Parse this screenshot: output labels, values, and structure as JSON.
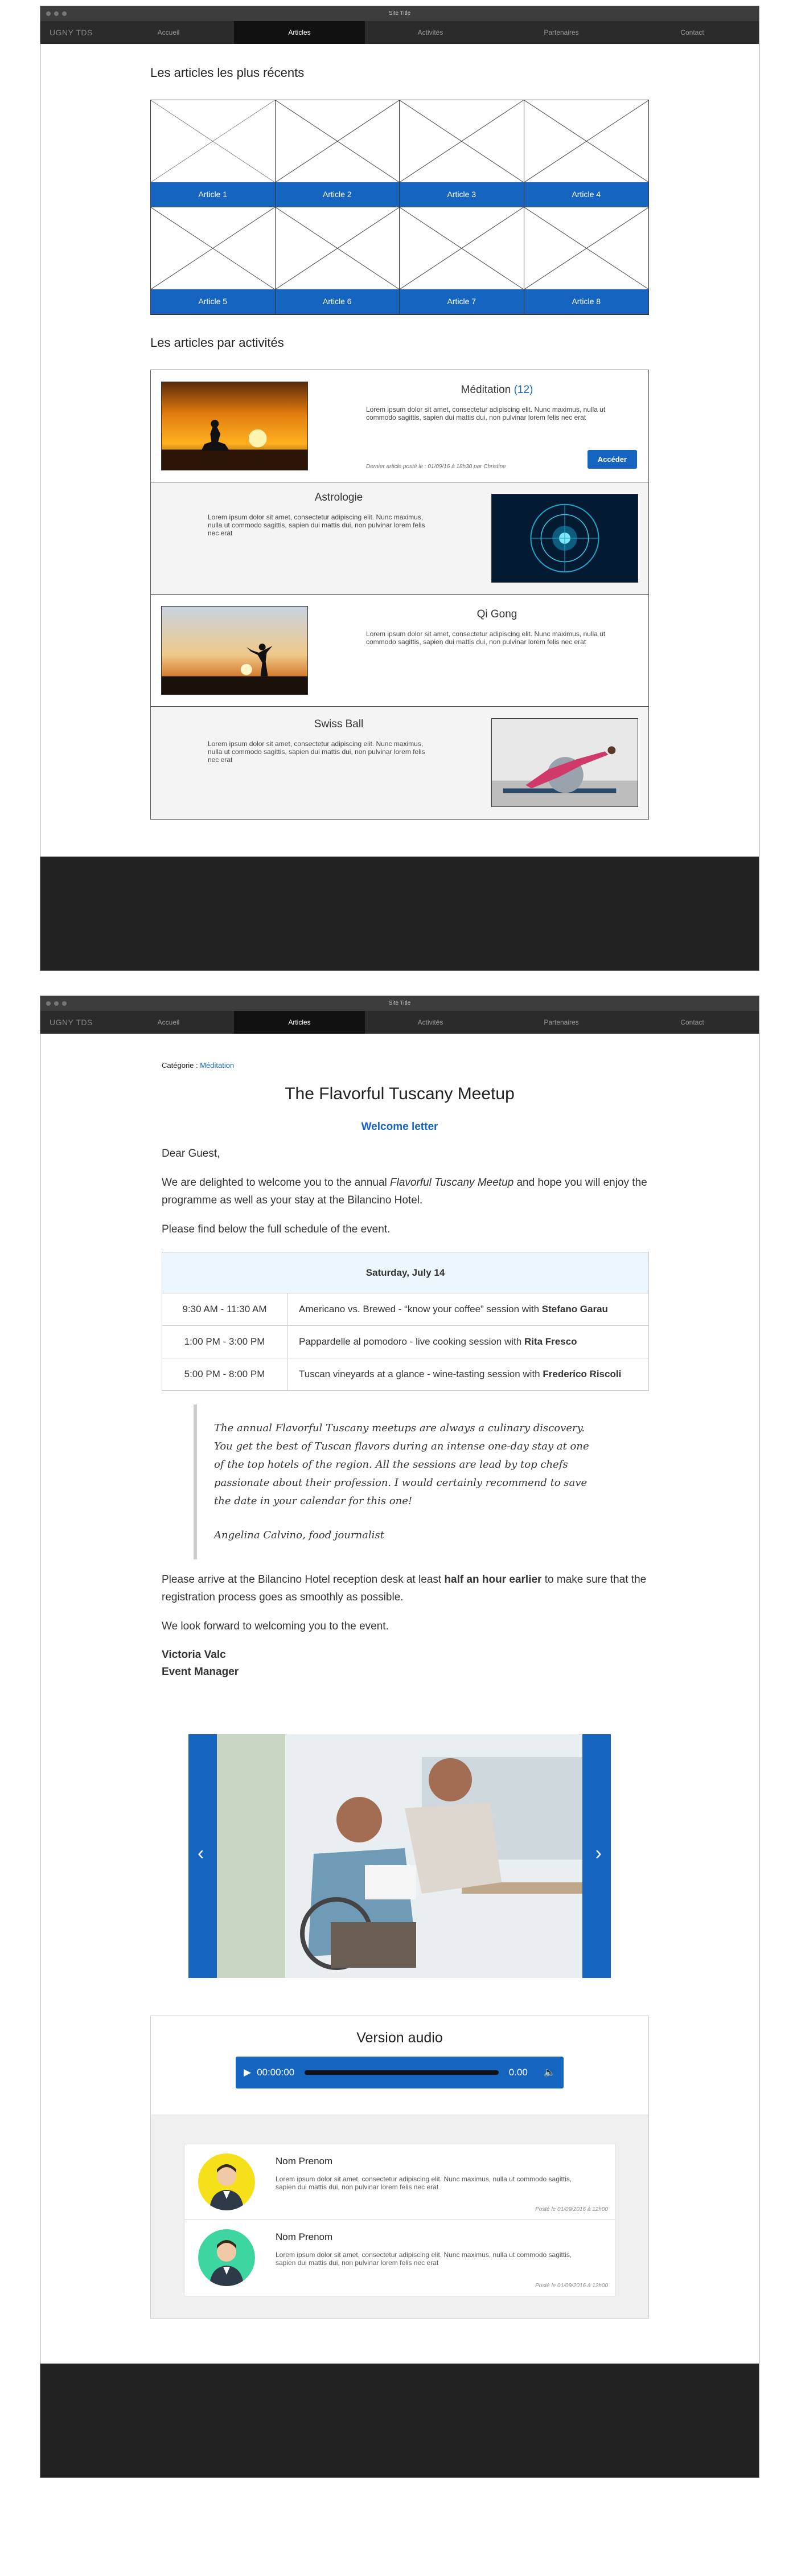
{
  "window": {
    "title": "Site Title"
  },
  "nav": {
    "logo": "UGNY TDS",
    "items": [
      "Accueil",
      "Articles",
      "Activités",
      "Partenaires",
      "Contact"
    ]
  },
  "listing": {
    "recent_title": "Les articles les plus récents",
    "articles": [
      "Article 1",
      "Article 2",
      "Article 3",
      "Article 4",
      "Article 5",
      "Article 6",
      "Article 7",
      "Article 8"
    ],
    "activities_title": "Les articles par activités",
    "activities": [
      {
        "name": "Méditation",
        "count": "(12)",
        "text": "Lorem ipsum dolor sit amet, consectetur adipiscing elit. Nunc maximus, nulla ut commodo sagittis, sapien dui mattis dui, non pulvinar lorem felis nec erat",
        "meta": "Dernier article posté le : 01/09/16 à 18h30 par Christine",
        "button": "Accéder"
      },
      {
        "name": "Astrologie",
        "text": "Lorem ipsum dolor sit amet, consectetur adipiscing elit. Nunc maximus, nulla ut commodo sagittis, sapien dui mattis dui, non pulvinar lorem felis nec erat"
      },
      {
        "name": "Qi Gong",
        "text": "Lorem ipsum dolor sit amet, consectetur adipiscing elit. Nunc maximus, nulla ut commodo sagittis, sapien dui mattis dui, non pulvinar lorem felis nec erat"
      },
      {
        "name": "Swiss Ball",
        "text": "Lorem ipsum dolor sit amet, consectetur adipiscing elit. Nunc maximus, nulla ut commodo sagittis, sapien dui mattis dui, non pulvinar lorem felis nec erat"
      }
    ]
  },
  "article": {
    "category_label": "Catégorie :",
    "category": "Méditation",
    "title": "The Flavorful Tuscany Meetup",
    "subtitle": "Welcome letter",
    "greeting": "Dear Guest,",
    "p1_a": "We are delighted to welcome you to the annual ",
    "p1_em": "Flavorful Tuscany Meetup",
    "p1_b": " and hope you will enjoy the programme as well as your stay at the Bilancino Hotel.",
    "p2": "Please find below the full schedule of the event.",
    "schedule_day": "Saturday, July 14",
    "schedule": [
      {
        "time": "9:30 AM - 11:30 AM",
        "desc": "Americano vs. Brewed - “know your coffee” session with ",
        "who": "Stefano Garau"
      },
      {
        "time": "1:00 PM - 3:00 PM",
        "desc": "Pappardelle al pomodoro - live cooking session with ",
        "who": "Rita Fresco"
      },
      {
        "time": "5:00 PM - 8:00 PM",
        "desc": "Tuscan vineyards at a glance - wine-tasting session with ",
        "who": "Frederico Riscoli"
      }
    ],
    "quote": "The annual Flavorful Tuscany meetups are always a culinary discovery. You get the best of Tuscan flavors during an intense one-day stay at one of the top hotels of the region. All the sessions are lead by top chefs passionate about their profession. I would certainly recommend to save the date in your calendar for this one!",
    "quote_author": "Angelina Calvino, food journalist",
    "p3_a": "Please arrive at the Bilancino Hotel reception desk at least ",
    "p3_strong": "half an hour earlier",
    "p3_b": " to make sure that the registration process goes as smoothly as possible.",
    "p4": "We look forward to welcoming you to the event.",
    "sig_name": "Victoria Valc",
    "sig_role": "Event Manager"
  },
  "audio": {
    "title": "Version audio",
    "time": "00:00:00",
    "duration": "0.00",
    "progress": 0
  },
  "comments": [
    {
      "name": "Nom Prenom",
      "text": "Lorem ipsum dolor sit amet, consectetur adipiscing elit. Nunc maximus, nulla ut commodo sagittis, sapien dui mattis dui, non pulvinar lorem felis nec erat",
      "date": "Posté le 01/09/2016 à 12h00",
      "color": "#f5e01a"
    },
    {
      "name": "Nom Prenom",
      "text": "Lorem ipsum dolor sit amet, consectetur adipiscing elit. Nunc maximus, nulla ut commodo sagittis, sapien dui mattis dui, non pulvinar lorem felis nec erat",
      "date": "Posté le 01/09/2016 à 12h00",
      "color": "#3ed6a0"
    }
  ],
  "colors": {
    "accent": "#1565c0",
    "nav_bg": "#2b2b2b",
    "footer_bg": "#222222"
  },
  "icons": {
    "prev": "chevron-left-icon",
    "next": "chevron-right-icon",
    "play": "play-icon",
    "volume": "volume-icon"
  }
}
